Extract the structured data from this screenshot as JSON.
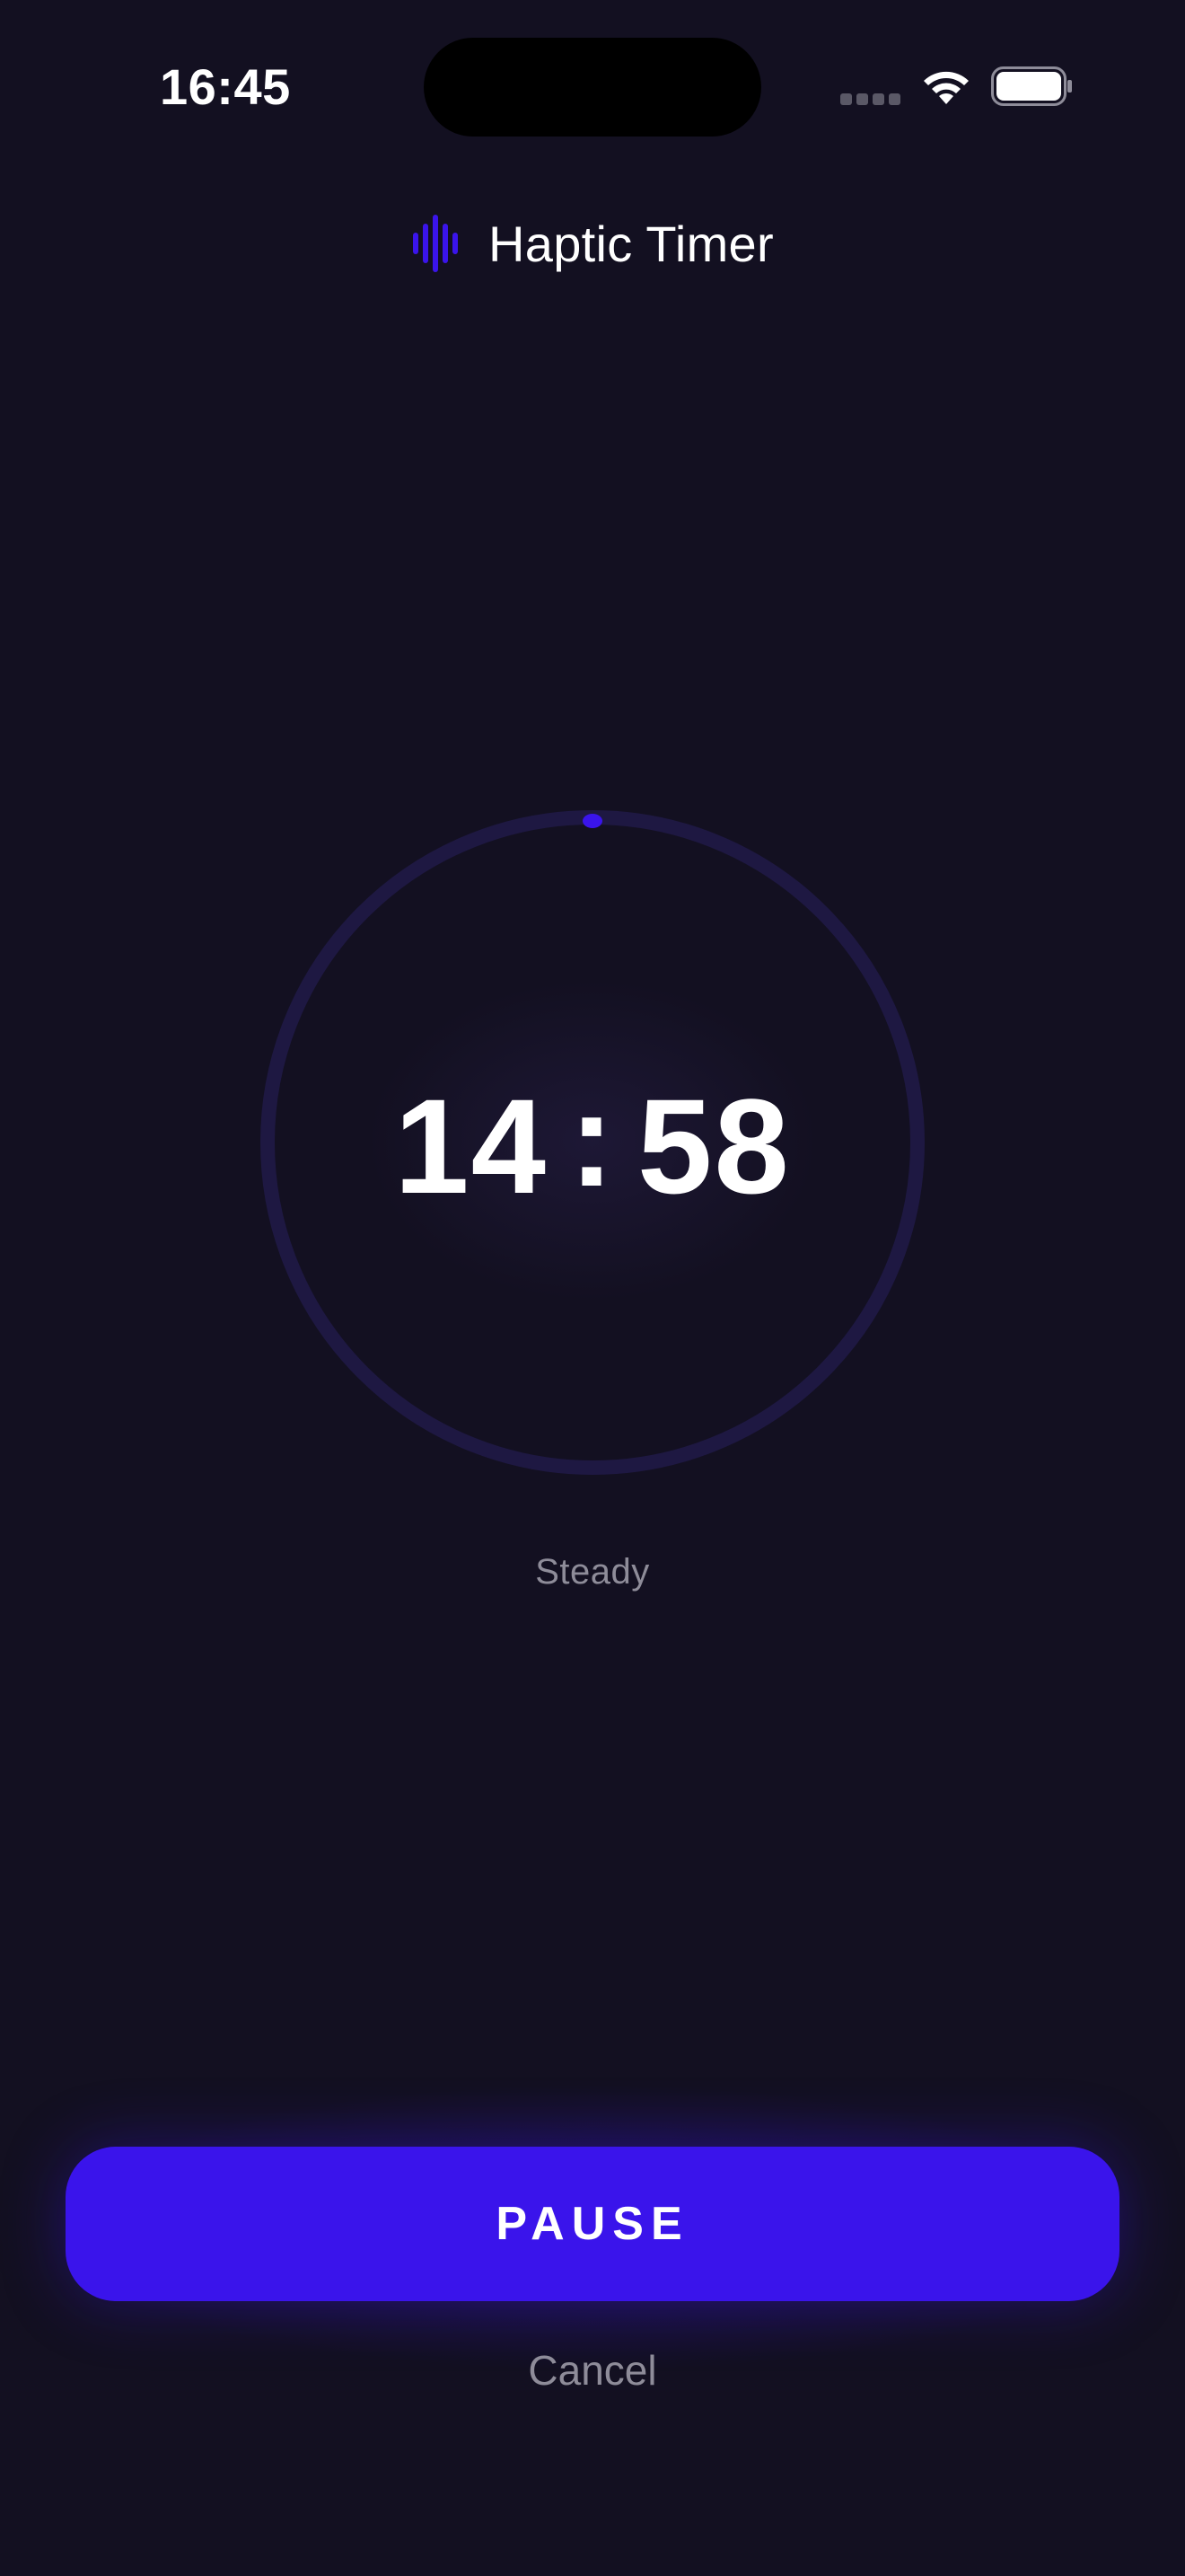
{
  "status_bar": {
    "time": "16:45",
    "signal_icon": "cellular-signal-icon",
    "wifi_icon": "wifi-icon",
    "battery_icon": "battery-icon"
  },
  "header": {
    "logo_icon": "haptic-waveform-icon",
    "title": "Haptic Timer"
  },
  "timer": {
    "minutes": "14",
    "separator": ":",
    "seconds": "58",
    "progress_fraction": 0.0,
    "mode": "Steady"
  },
  "controls": {
    "pause_label": "PAUSE",
    "cancel_label": "Cancel"
  },
  "colors": {
    "background": "#131021",
    "accent": "#3a14eb",
    "ring_track": "#1e1842",
    "muted_text": "#8e8c99"
  }
}
